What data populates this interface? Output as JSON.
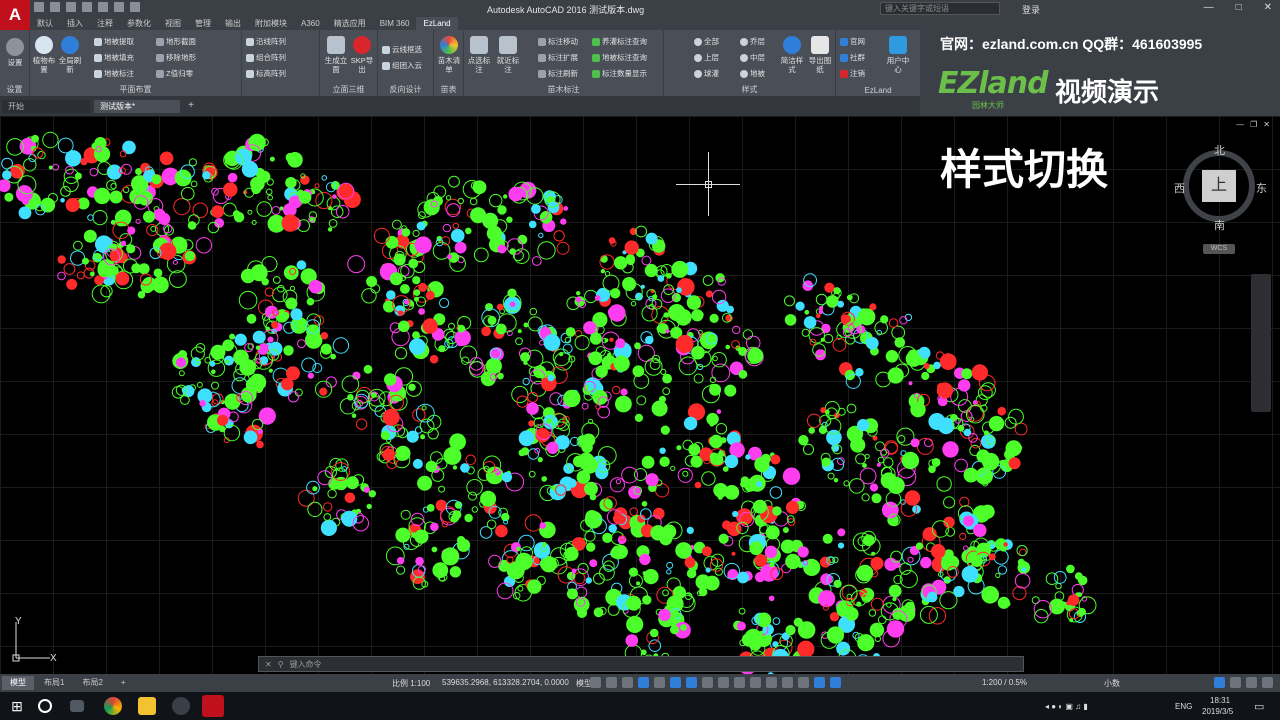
{
  "window": {
    "title": "Autodesk AutoCAD 2016    测试版本.dwg",
    "app_logo": "A",
    "search_placeholder": "键入关键字或短语",
    "login": "登录",
    "controls": [
      "—",
      "□",
      "✕"
    ]
  },
  "ribbon_tabs": [
    "默认",
    "插入",
    "注释",
    "参数化",
    "视图",
    "管理",
    "输出",
    "附加模块",
    "A360",
    "精选应用",
    "BIM 360",
    "EzLand"
  ],
  "active_ribbon_tab": "EzLand",
  "ribbon": {
    "settings": {
      "label": "设置",
      "buttons": [
        "设置"
      ]
    },
    "plan": {
      "label": "平面布置",
      "buttons": [
        "植物布置",
        "全局刷新",
        "地被提取",
        "地被填充",
        "地被标注",
        "地形截面",
        "移除地形",
        "Z值归零"
      ]
    },
    "array": {
      "buttons": [
        "沿线阵列",
        "组合阵列",
        "标高阵列"
      ]
    },
    "elevation": {
      "label": "立面三维",
      "buttons": [
        "生成立面",
        "SKP导出"
      ]
    },
    "reverse": {
      "label": "反向设计",
      "buttons": [
        "云线框选",
        "组团入云"
      ]
    },
    "seedling": {
      "label": "苗表",
      "buttons": [
        "苗木清单"
      ]
    },
    "annotation": {
      "label": "苗木标注",
      "buttons": [
        "点选标注",
        "就近标注",
        "标注移动",
        "标注扩展",
        "标注刷新",
        "养灌标注查询",
        "地被标注查询",
        "标注数量显示"
      ]
    },
    "style": {
      "label": "样式",
      "buttons": [
        "全部",
        "上层",
        "球灌",
        "乔层",
        "中层",
        "地被",
        "简洁样式",
        "导出图纸"
      ]
    },
    "ezland": {
      "label": "EzLand",
      "buttons": [
        "官网",
        "社群",
        "注销",
        "用户中心"
      ]
    }
  },
  "banner": {
    "site_text": "官网：ezland.com.cn QQ群：461603995",
    "logo_text": "EZland",
    "logo_sub": "园林大师",
    "video_text": "视频演示"
  },
  "doc_tabs": [
    "开始",
    "测试版本*"
  ],
  "canvas": {
    "overlay_title": "样式切换",
    "viewport_controls": [
      "—",
      "❐",
      "✕"
    ],
    "viewcube": {
      "north": "北",
      "south": "南",
      "west": "西",
      "east": "东",
      "face": "上",
      "wcs": "WCS"
    },
    "ucs": {
      "x": "X",
      "y": "Y"
    },
    "command_placeholder": "键入命令"
  },
  "status": {
    "layout_tabs": [
      "模型",
      "布局1",
      "布局2"
    ],
    "scale": "比例 1:100",
    "coords": "539635.2968, 613328.2704, 0.0000",
    "model_label": "模型",
    "annotation_scale": "1:200 / 0.5%",
    "units": "小数"
  },
  "taskbar": {
    "time": "18:31",
    "date": "2019/3/5",
    "lang": "ENG"
  },
  "colors": {
    "plant_green": "#4cff2a",
    "plant_magenta": "#ff3df0",
    "plant_red": "#ff2a2a",
    "plant_cyan": "#3fe0ff",
    "brand_green": "#6cc04a",
    "app_red": "#c0101b"
  }
}
